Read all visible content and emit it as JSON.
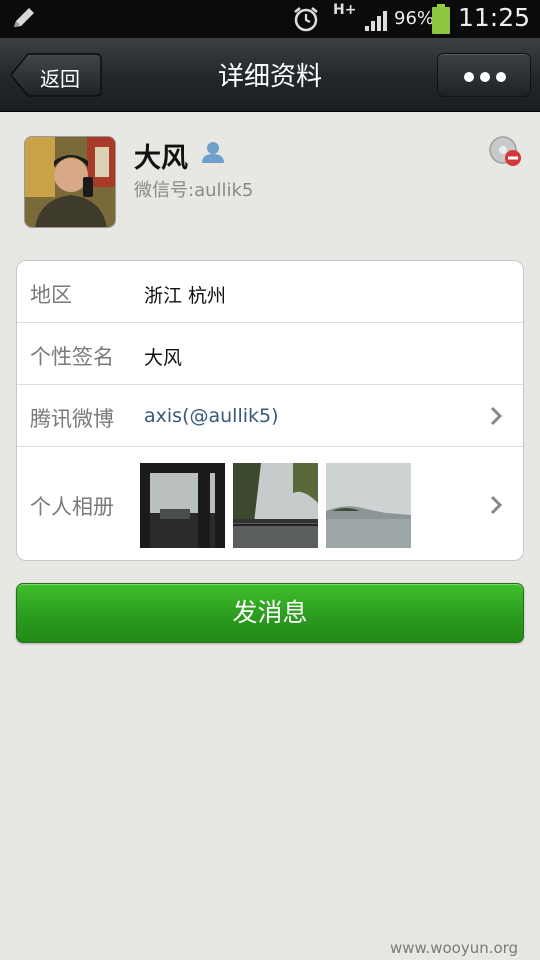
{
  "status_bar": {
    "network": "H+",
    "battery": "96%",
    "time": "11:25"
  },
  "header": {
    "back_label": "返回",
    "title": "详细资料"
  },
  "profile": {
    "name": "大风",
    "wechat_id": "微信号:aullik5"
  },
  "details": [
    {
      "label": "地区",
      "value": "浙江  杭州"
    },
    {
      "label": "个性签名",
      "value": "大风"
    },
    {
      "label": "腾讯微博",
      "value": "axis(@aullik5)"
    },
    {
      "label": "个人相册",
      "photo_count": 3
    }
  ],
  "send_button": "发消息",
  "watermark": "www.wooyun.org",
  "colors": {
    "accent_green": "#2b9c1f",
    "link_blue": "#385a7a",
    "background": "#e7e7e3"
  },
  "icons": [
    "pencil-icon",
    "alarm-icon",
    "signal-icon",
    "battery-icon",
    "back-arrow-icon",
    "more-dots-icon",
    "person-icon",
    "blocked-icon",
    "chevron-right-icon"
  ]
}
